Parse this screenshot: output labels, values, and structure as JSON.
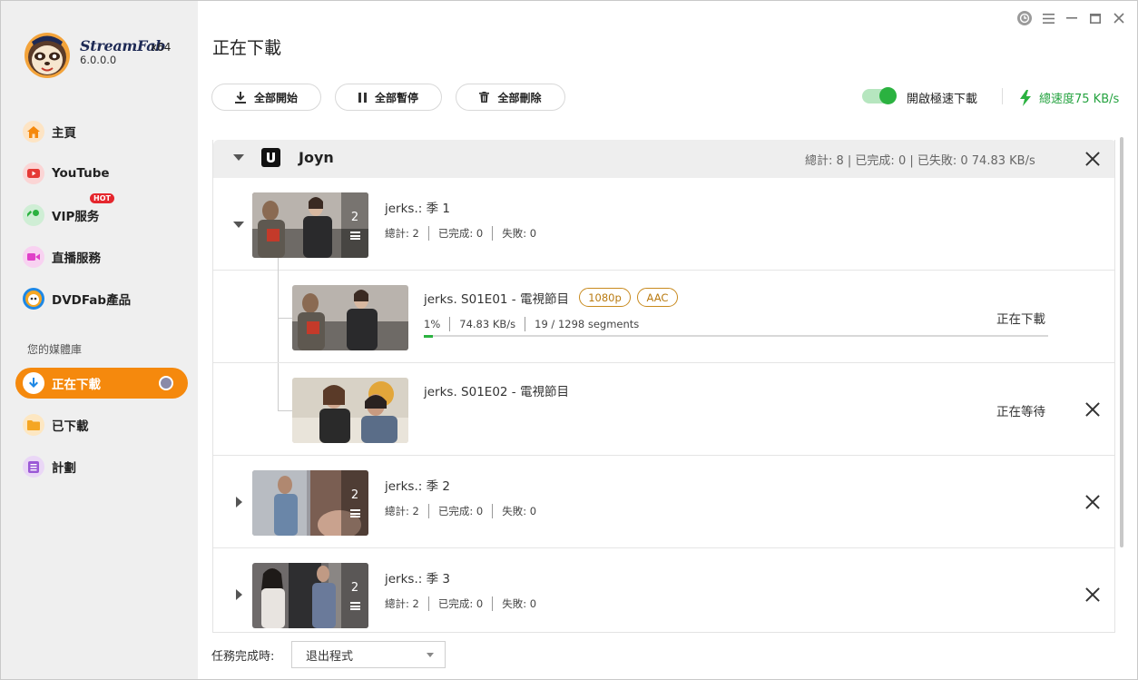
{
  "app": {
    "brand": "StreamFab",
    "arch": "x64",
    "version": "6.0.0.0"
  },
  "sidebar": {
    "items": [
      {
        "label": "主頁",
        "icon": "home-icon",
        "color": "#f5890d"
      },
      {
        "label": "YouTube",
        "icon": "youtube-icon",
        "color": "#e53935"
      },
      {
        "label": "VIP服务",
        "icon": "key-icon",
        "color": "#2bb240",
        "badge": "HOT"
      },
      {
        "label": "直播服務",
        "icon": "video-camera-icon",
        "color": "#e040c8"
      },
      {
        "label": "DVDFab產品",
        "icon": "dvdfab-icon",
        "color": "#1e88e5"
      }
    ],
    "library_label": "您的媒體庫",
    "library_items": [
      {
        "label": "正在下載",
        "icon": "download-icon",
        "active": true
      },
      {
        "label": "已下載",
        "icon": "folder-icon",
        "color": "#f5a623"
      },
      {
        "label": "計劃",
        "icon": "schedule-icon",
        "color": "#9b59d6"
      }
    ]
  },
  "header": {
    "title": "正在下載"
  },
  "toolbar": {
    "start_all": "全部開始",
    "pause_all": "全部暫停",
    "delete_all": "全部刪除",
    "turbo_label": "開啟極速下載",
    "turbo_on": true,
    "total_speed": "總速度75 KB/s"
  },
  "group": {
    "name": "Joyn",
    "stats": "總計: 8 | 已完成: 0 | 已失敗: 0    74.83 KB/s"
  },
  "labels": {
    "total": "總計:",
    "done": "已完成:",
    "failed": "失敗:"
  },
  "seasons": [
    {
      "title": "jerks.: 季 1",
      "count": "2",
      "total": "2",
      "done": "0",
      "failed": "0",
      "episodes": [
        {
          "title": "jerks. S01E01 - 電視節目",
          "tags": [
            "1080p",
            "AAC"
          ],
          "percent": "1%",
          "speed": "74.83 KB/s",
          "segments": "19 / 1298 segments",
          "progress": 0.01,
          "status": "正在下載"
        },
        {
          "title": "jerks. S01E02 - 電視節目",
          "status": "正在等待"
        }
      ]
    },
    {
      "title": "jerks.: 季 2",
      "count": "2",
      "total": "2",
      "done": "0",
      "failed": "0"
    },
    {
      "title": "jerks.: 季 3",
      "count": "2",
      "total": "2",
      "done": "0",
      "failed": "0"
    }
  ],
  "footer": {
    "label": "任務完成時:",
    "select_value": "退出程式"
  }
}
